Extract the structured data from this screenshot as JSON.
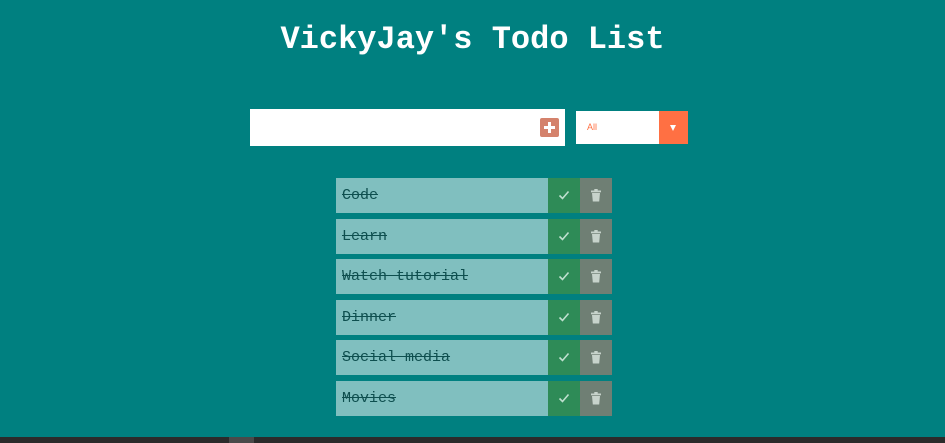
{
  "header": {
    "title": "VickyJay's Todo List"
  },
  "form": {
    "input_value": "",
    "input_placeholder": "",
    "add_icon": "plus-icon",
    "filter": {
      "selected": "All",
      "icon": "chevron-down-icon"
    }
  },
  "todos": [
    {
      "text": "Code",
      "completed": true
    },
    {
      "text": "Learn",
      "completed": true
    },
    {
      "text": "Watch tutorial",
      "completed": true
    },
    {
      "text": "Dinner",
      "completed": true
    },
    {
      "text": "Social media",
      "completed": true
    },
    {
      "text": "Movies",
      "completed": true
    }
  ],
  "colors": {
    "background": "#008080",
    "item_background": "#80bfbf",
    "check_button": "#2e8b57",
    "trash_button": "#6f7f74",
    "accent": "#ff7043",
    "add_button": "#d4826c"
  },
  "icons": {
    "check": "check-icon",
    "trash": "trash-icon"
  }
}
